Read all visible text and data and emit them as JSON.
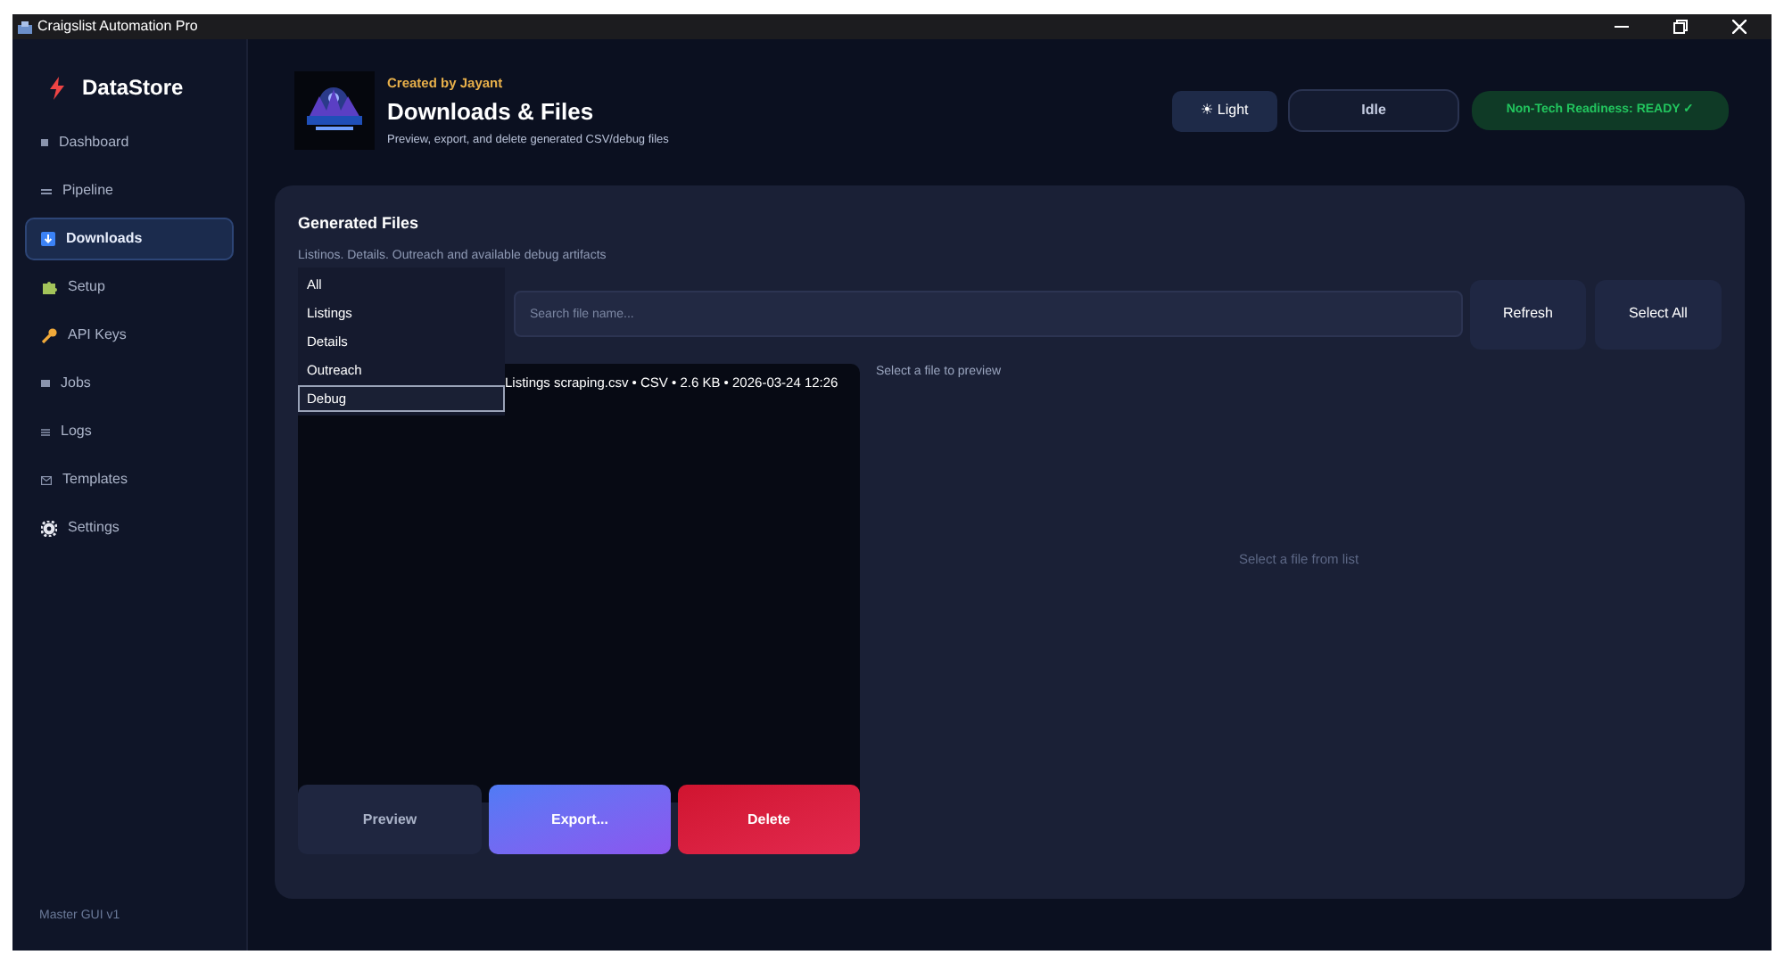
{
  "window": {
    "title": "Craigslist Automation Pro"
  },
  "sidebar": {
    "brand": "DataStore",
    "items": [
      {
        "label": "Dashboard",
        "selected": false
      },
      {
        "label": "Pipeline",
        "selected": false
      },
      {
        "label": "Downloads",
        "selected": true
      },
      {
        "label": "Setup",
        "selected": false
      },
      {
        "label": "API Keys",
        "selected": false
      },
      {
        "label": "Jobs",
        "selected": false
      },
      {
        "label": "Logs",
        "selected": false
      },
      {
        "label": "Templates",
        "selected": false
      },
      {
        "label": "Settings",
        "selected": false
      }
    ],
    "footer": "Master GUI v1"
  },
  "header": {
    "credit": "Created by Jayant",
    "title": "Downloads & Files",
    "subtitle": "Preview, export, and delete generated CSV/debug files",
    "theme_button": "☀ Light",
    "status": "Idle",
    "readiness": "Non-Tech Readiness: READY ✓"
  },
  "panel": {
    "title": "Generated Files",
    "subtitle": "Listinos. Details. Outreach and available debug artifacts",
    "filter_options": [
      {
        "label": "All",
        "selected": false
      },
      {
        "label": "Listings",
        "selected": false
      },
      {
        "label": "Details",
        "selected": false
      },
      {
        "label": "Outreach",
        "selected": false
      },
      {
        "label": "Debug",
        "selected": true
      }
    ],
    "search": {
      "placeholder": "Search file name..."
    },
    "buttons": [
      "Refresh",
      "Select All"
    ],
    "files": [
      "Listings scraping.csv • CSV • 2.6 KB • 2026-03-24 12:26"
    ],
    "preview_hint": "Select a file to preview",
    "preview_empty": "Select a file from list",
    "actions": [
      {
        "label": "Preview",
        "kind": "plain"
      },
      {
        "label": "Export...",
        "kind": "primary"
      },
      {
        "label": "Delete",
        "kind": "danger"
      }
    ]
  }
}
